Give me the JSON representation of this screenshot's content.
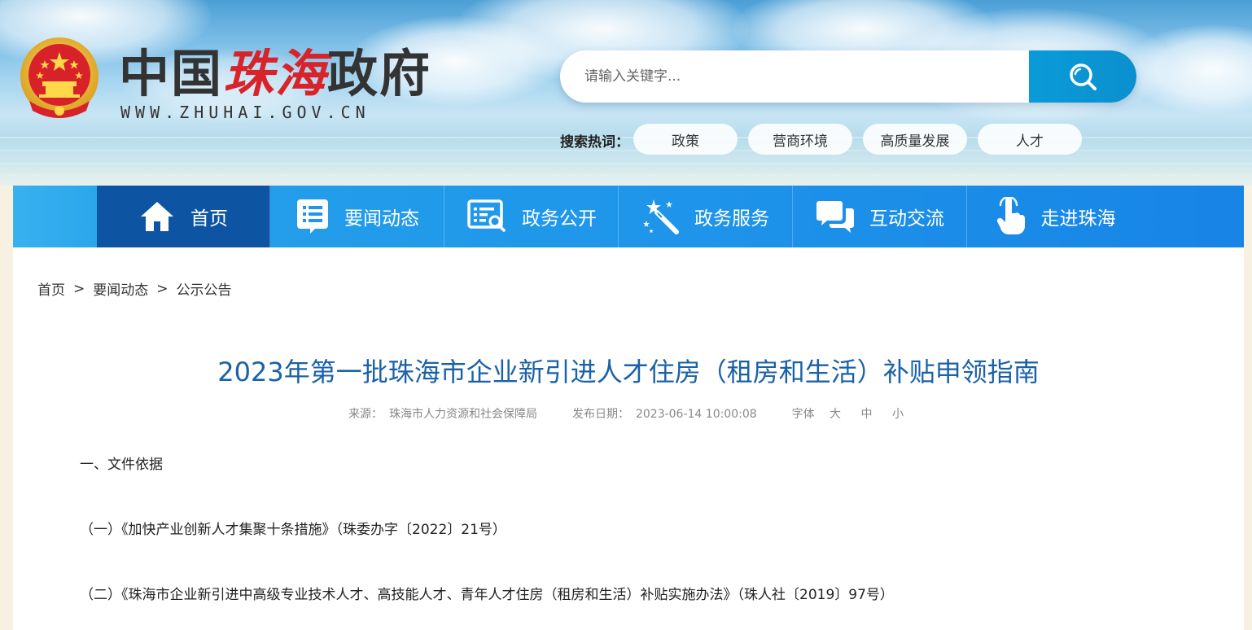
{
  "site": {
    "logo_part1": "中国",
    "logo_part2": "珠海",
    "logo_part3": "政府",
    "url": "WWW.ZHUHAI.GOV.CN"
  },
  "search": {
    "placeholder": "请输入关键字...",
    "hot_label": "搜索热词：",
    "hot_tags": [
      "政策",
      "营商环境",
      "高质量发展",
      "人才"
    ]
  },
  "nav": {
    "items": [
      {
        "label": "首页",
        "icon": "home-icon",
        "active": true
      },
      {
        "label": "要闻动态",
        "icon": "news-list-icon",
        "active": false
      },
      {
        "label": "政务公开",
        "icon": "open-affairs-icon",
        "active": false
      },
      {
        "label": "政务服务",
        "icon": "magic-wand-icon",
        "active": false
      },
      {
        "label": "互动交流",
        "icon": "chat-icon",
        "active": false
      },
      {
        "label": "走进珠海",
        "icon": "pointer-hand-icon",
        "active": false
      }
    ]
  },
  "breadcrumb": {
    "items": [
      "首页",
      "要闻动态",
      "公示公告"
    ],
    "separator": ">"
  },
  "article": {
    "title": "2023年第一批珠海市企业新引进人才住房（租房和生活）补贴申领指南",
    "source_label": "来源：",
    "source": "珠海市人力资源和社会保障局",
    "date_label": "发布日期：",
    "date": "2023-06-14 10:00:08",
    "font_label": "字体",
    "font_sizes": [
      "大",
      "中",
      "小"
    ],
    "paragraphs": [
      "一、文件依据",
      "（一）《加快产业创新人才集聚十条措施》（珠委办字〔2022〕21号）",
      "（二）《珠海市企业新引进中高级专业技术人才、高技能人才、青年人才住房（租房和生活）补贴实施办法》（珠人社〔2019〕97号）"
    ]
  },
  "colors": {
    "nav_active": "#0d55a3",
    "nav_bg": "#1f96ea",
    "title": "#1a62a8",
    "search_button": "#0a9bd8",
    "logo_red": "#d9232a"
  }
}
